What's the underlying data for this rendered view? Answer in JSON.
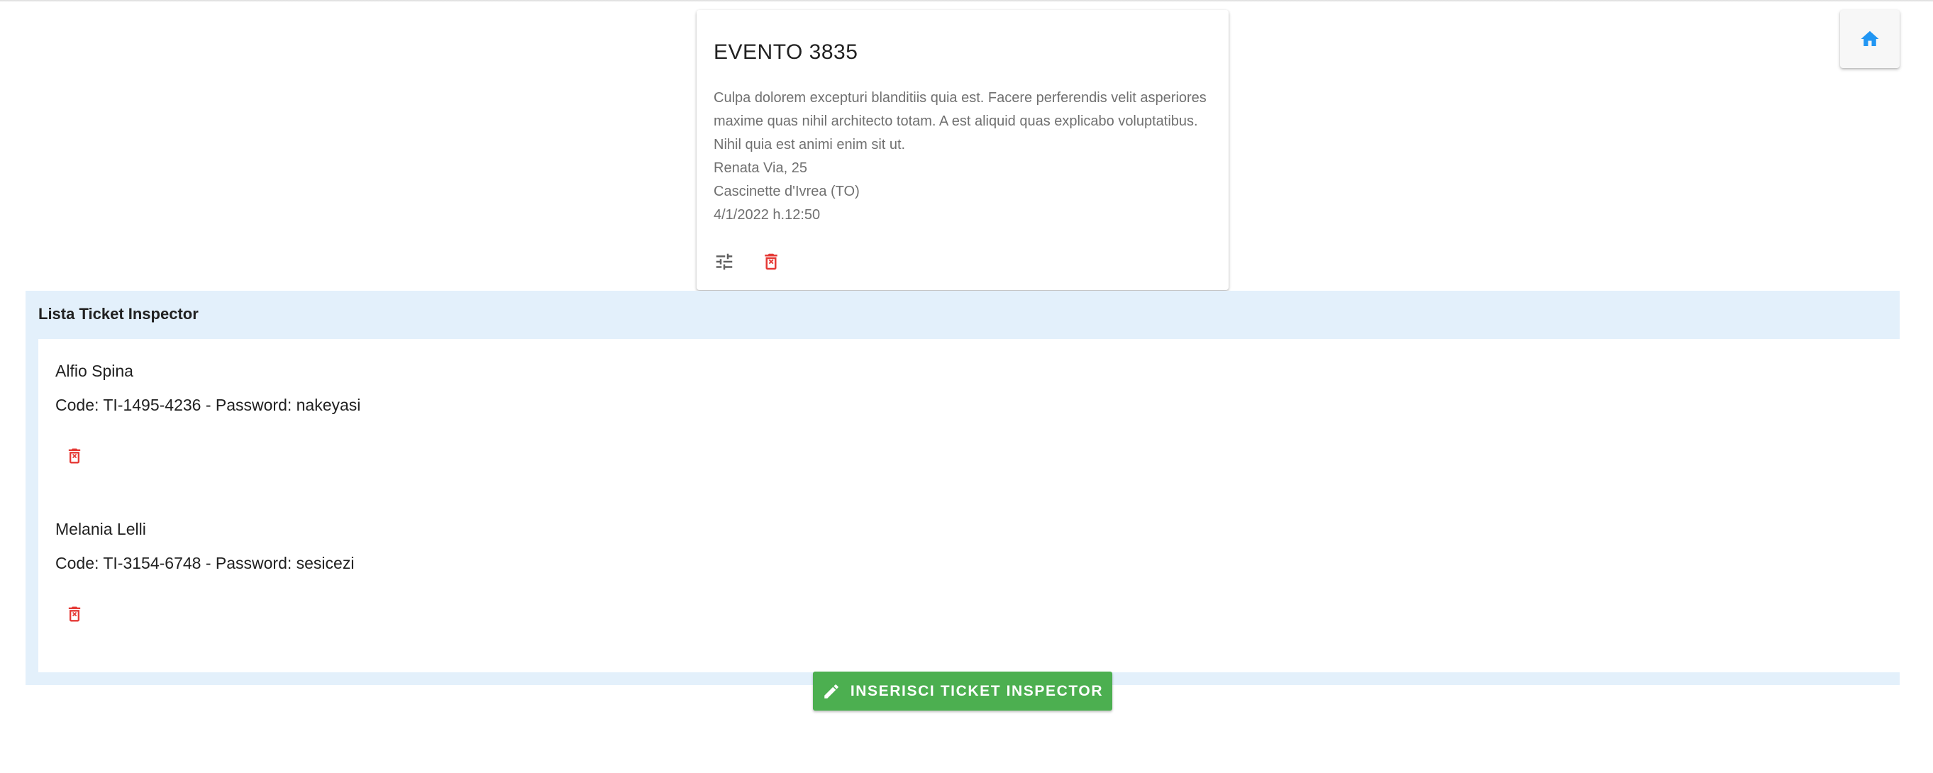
{
  "header": {
    "home_icon": "home-icon",
    "accent_color": "#2196f3"
  },
  "event": {
    "title": "EVENTO 3835",
    "description": "Culpa dolorem excepturi blanditiis quia est. Facere perferendis velit asperiores maxime quas nihil architecto totam. A est aliquid quas explicabo voluptatibus. Nihil quia est animi enim sit ut.",
    "address": "Renata Via, 25",
    "city": "Cascinette d'Ivrea (TO)",
    "datetime": "4/1/2022 h.12:50",
    "actions": [
      {
        "icon": "tune-icon"
      },
      {
        "icon": "delete-icon",
        "color": "#e53935"
      }
    ]
  },
  "inspectors": {
    "title": "Lista Ticket Inspector",
    "items": [
      {
        "name": "Alfio Spina",
        "code_line": "Code: TI-1495-4236 - Password: nakeyasi"
      },
      {
        "name": "Melania Lelli",
        "code_line": "Code: TI-3154-6748 - Password: sesicezi"
      }
    ]
  },
  "add_button": {
    "label": "INSERISCI TICKET INSPECTOR",
    "icon": "pencil-icon",
    "color": "#4caf50"
  }
}
